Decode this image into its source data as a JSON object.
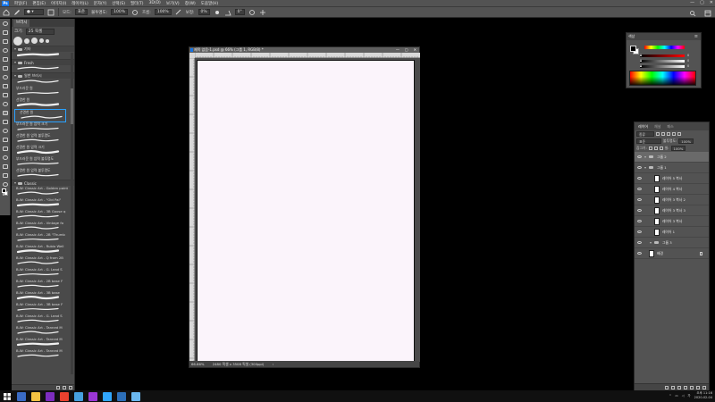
{
  "app": {
    "logo_text": "Ps",
    "menu": [
      "파일(F)",
      "편집(E)",
      "이미지(I)",
      "레이어(L)",
      "문자(Y)",
      "선택(S)",
      "필터(T)",
      "3D(D)",
      "보기(V)",
      "창(W)",
      "도움말(H)"
    ],
    "window_controls": [
      "—",
      "▢",
      "✕"
    ]
  },
  "options_bar": {
    "mode_label": "모드:",
    "mode_value": "표준",
    "opacity_label": "불투명도:",
    "opacity_value": "100%",
    "flow_label": "흐름:",
    "flow_value": "100%",
    "smoothing_label": "보정:",
    "smoothing_value": "0%",
    "angle_value": "0°"
  },
  "brush_panel": {
    "tab": "브러시",
    "size_label": "크기:",
    "size_value": "25 픽셀",
    "preset_sizes": [
      10,
      6,
      7,
      5,
      4
    ],
    "folders": [
      {
        "name": "기타",
        "items": []
      },
      {
        "name": "Fresh",
        "items": []
      },
      {
        "name": "일반 브러시",
        "items": [
          "부드러운 원",
          "선명한 원",
          "선명한 원"
        ]
      },
      {
        "name": "",
        "items": [
          "부드러운 원 압력 크기",
          "선명한 원 압력 불투명도",
          "선명한 원 압력 크기",
          "부드러운 원 압력 불투명도",
          "선명한 원 압력 불투명도"
        ]
      },
      {
        "name": "Classic",
        "items": [
          "B-W: Classic Art - Golden paint",
          "B-W: Classic Art - \"Old Pai\"",
          "B-W: Classic Art - 3B Goose q",
          "B-W: Classic Art - Vintage fo",
          "B-W: Classic Art - 2B \"Thumb",
          "B-W: Classic Art - Rubio Well",
          "B-W: Classic Art - Q from 2B",
          "B-W: Classic Art - G. Lead S",
          "B-W: Classic Art - 2B base F",
          "B-W: Classic Art - 3B base",
          "B-W: Classic Art - 3B base F",
          "B-W: Classic Art - G. Lead S",
          "B-W: Classic Art - Tanned M",
          "B-W: Classic Art - Tanned M",
          "B-W: Classic Art - Tanned M"
        ]
      }
    ]
  },
  "document": {
    "title": "제목 없음-1.psd @ 66% (그룹 1, RGB/8) *",
    "zoom": "66.66%",
    "doc_info": "2480 픽셀 x 3508 픽셀 (300ppi)",
    "doc_ctrls": [
      "—",
      "▢",
      "✕"
    ]
  },
  "color_panel": {
    "tab": "색상",
    "values": [
      0,
      0,
      0
    ]
  },
  "layers_panel": {
    "tabs": [
      "레이어",
      "채널",
      "패스"
    ],
    "filter_label": "종류",
    "blend_mode": "표준",
    "opacity_label": "불투명도:",
    "opacity_value": "100%",
    "lock_label": "잠그기:",
    "fill_label": "칠:",
    "fill_value": "100%",
    "layers": [
      {
        "name": "그룹 2",
        "type": "group",
        "indent": 0,
        "selected": true
      },
      {
        "name": "그룹 1",
        "type": "group",
        "indent": 0,
        "selected": false
      },
      {
        "name": "레이어 5 복사",
        "type": "layer",
        "indent": 1,
        "selected": false
      },
      {
        "name": "레이어 4 복사",
        "type": "layer",
        "indent": 1,
        "selected": false
      },
      {
        "name": "레이어 3 복사 2",
        "type": "layer",
        "indent": 1,
        "selected": false
      },
      {
        "name": "레이어 3 복사 3",
        "type": "layer",
        "indent": 1,
        "selected": false
      },
      {
        "name": "레이어 3 복사",
        "type": "layer",
        "indent": 1,
        "selected": false
      },
      {
        "name": "레이어 1",
        "type": "layer",
        "indent": 1,
        "selected": false
      },
      {
        "name": "그룹 3",
        "type": "group",
        "indent": 1,
        "selected": false
      },
      {
        "name": "배경",
        "type": "background",
        "indent": 0,
        "selected": false
      }
    ]
  },
  "taskbar": {
    "time": "오후 11:16",
    "date": "2020-02-04",
    "apps": [
      "#3a6bc4",
      "#f4c243",
      "#7d2dbf",
      "#e8412e",
      "#46a1e0",
      "#9b37d4",
      "#31a8ff",
      "#2d6fb8",
      "#6bb8f0"
    ]
  },
  "colors": {
    "canvas": "#fbf4fb",
    "ui_bg": "#535353",
    "accent": "#2aa1ff"
  }
}
